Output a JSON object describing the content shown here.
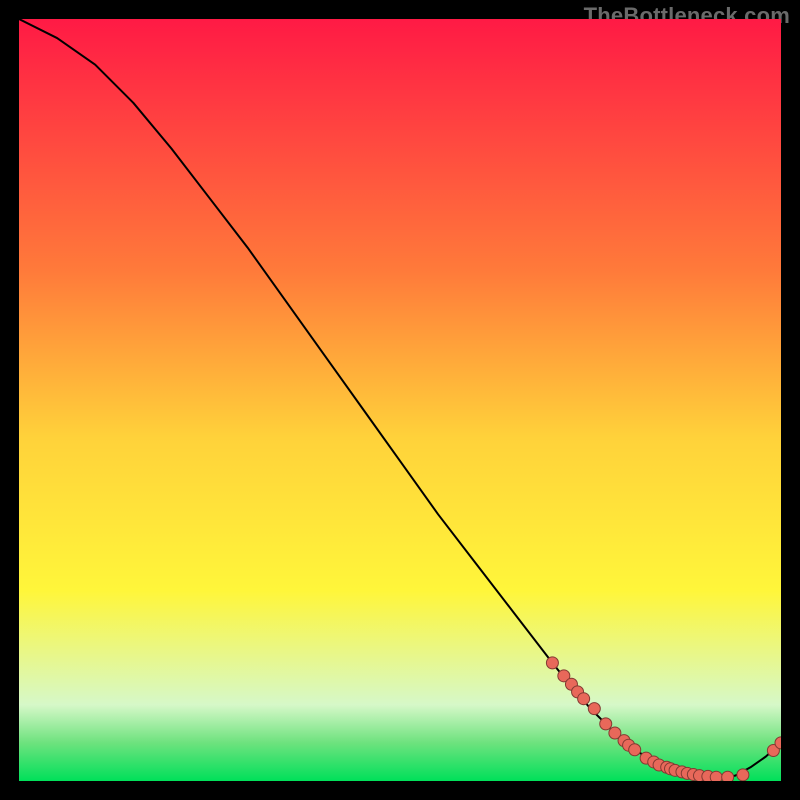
{
  "watermark": "TheBottleneck.com",
  "colors": {
    "frame": "#000000",
    "curve": "#000000",
    "dot_fill": "#e8685a",
    "dot_stroke": "#833a32",
    "grad_top": "#ff1a45",
    "grad_mid_upper": "#ff7a3a",
    "grad_mid": "#ffd23a",
    "grad_mid_lower": "#fff63a",
    "grad_green_pale": "#d6f8c8",
    "grad_green_mid": "#6de27e",
    "grad_bottom": "#00e05a"
  },
  "chart_data": {
    "type": "line",
    "title": "",
    "xlabel": "",
    "ylabel": "",
    "xlim": [
      0,
      100
    ],
    "ylim": [
      0,
      100
    ],
    "series": [
      {
        "name": "bottleneck-curve",
        "x": [
          0,
          5,
          10,
          15,
          20,
          25,
          30,
          35,
          40,
          45,
          50,
          55,
          60,
          65,
          70,
          72,
          75,
          77,
          79,
          81,
          83,
          85,
          87,
          90,
          92,
          94,
          96,
          98,
          100
        ],
        "y": [
          100,
          97.5,
          94,
          89,
          83,
          76.5,
          70,
          63,
          56,
          49,
          42,
          35,
          28.5,
          22,
          15.5,
          13,
          9.5,
          7.5,
          5.5,
          4,
          2.7,
          1.8,
          1.2,
          0.6,
          0.4,
          0.7,
          1.8,
          3.2,
          5
        ]
      }
    ],
    "scatter": {
      "name": "marked-points",
      "x": [
        70,
        71.5,
        72.5,
        73.3,
        74.1,
        75.5,
        77,
        78.2,
        79.4,
        80,
        80.8,
        82.3,
        83.3,
        84,
        85,
        85.5,
        86.1,
        87,
        87.7,
        88.5,
        89.3,
        90.4,
        91.5,
        93,
        95,
        99,
        100
      ],
      "y": [
        15.5,
        13.8,
        12.7,
        11.7,
        10.8,
        9.5,
        7.5,
        6.3,
        5.3,
        4.7,
        4.1,
        3.0,
        2.5,
        2.1,
        1.8,
        1.6,
        1.4,
        1.2,
        1.0,
        0.85,
        0.7,
        0.6,
        0.5,
        0.5,
        0.8,
        4.0,
        5.0
      ]
    }
  }
}
